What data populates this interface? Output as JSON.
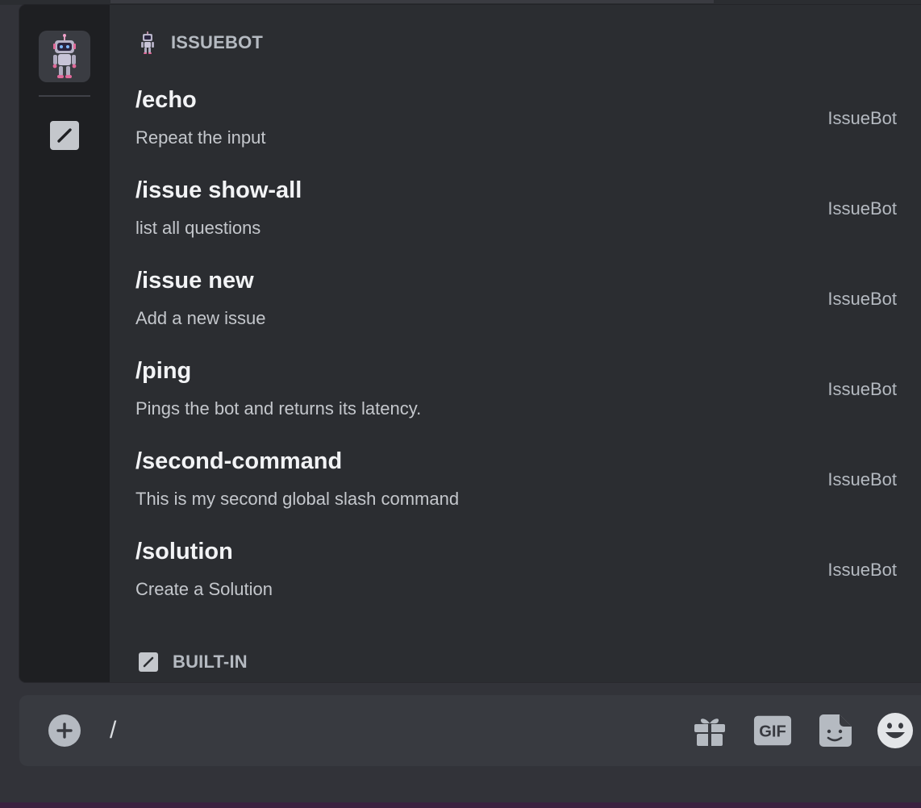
{
  "autocomplete": {
    "sections": [
      {
        "title": "ISSUEBOT",
        "icon": "robot-avatar-icon",
        "commands": [
          {
            "name": "/echo",
            "description": "Repeat the input",
            "source": "IssueBot"
          },
          {
            "name": "/issue show-all",
            "description": "list all questions",
            "source": "IssueBot"
          },
          {
            "name": "/issue new",
            "description": "Add a new issue",
            "source": "IssueBot"
          },
          {
            "name": "/ping",
            "description": "Pings the bot and returns its latency.",
            "source": "IssueBot"
          },
          {
            "name": "/second-command",
            "description": "This is my second global slash command",
            "source": "IssueBot"
          },
          {
            "name": "/solution",
            "description": "Create a Solution",
            "source": "IssueBot"
          }
        ]
      },
      {
        "title": "BUILT-IN",
        "icon": "slash-command-icon",
        "commands": []
      }
    ],
    "rail": [
      "robot-avatar-icon",
      "slash-command-icon"
    ]
  },
  "chat_input": {
    "value": "/",
    "tools": [
      "gift-icon",
      "gif-icon",
      "sticker-icon",
      "emoji-icon"
    ],
    "gif_label": "GIF"
  },
  "colors": {
    "background": "#323339",
    "popup": "#2b2d31",
    "rail": "#1e1f22",
    "input": "#383a40",
    "text_primary": "#f2f3f5",
    "text_muted": "#b5bac1"
  }
}
